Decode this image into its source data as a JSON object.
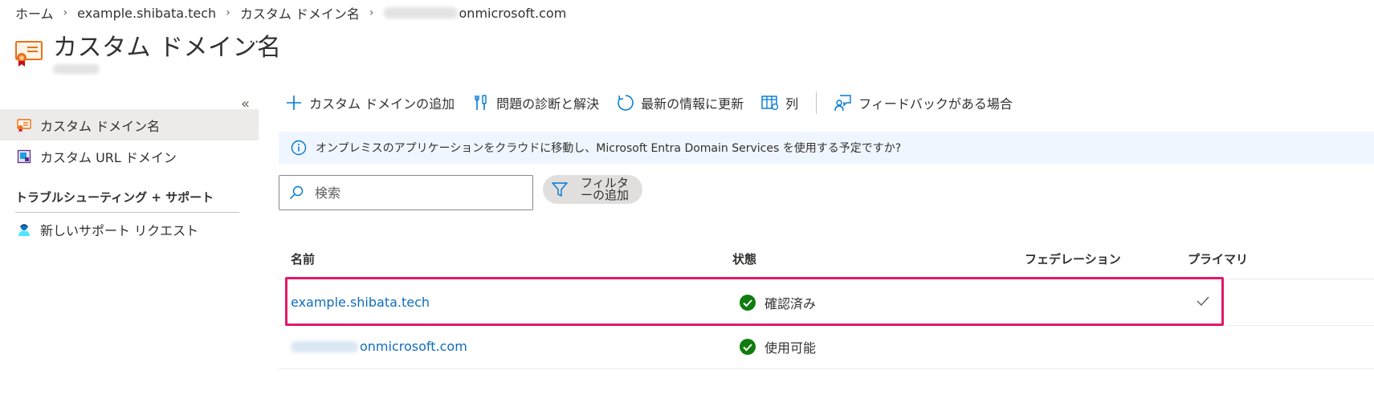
{
  "breadcrumb": {
    "home": "ホーム",
    "domain": "example.shibata.tech",
    "page": "カスタム ドメイン名",
    "tenant_suffix": "onmicrosoft.com"
  },
  "page": {
    "title": "カスタム ドメイン名",
    "more": "···",
    "collapse": "«"
  },
  "nav": {
    "items": [
      {
        "label": "カスタム ドメイン名",
        "icon": "certificate-icon",
        "active": true
      },
      {
        "label": "カスタム URL ドメイン",
        "icon": "url-domain-icon",
        "active": false
      }
    ],
    "section_title": "トラブルシューティング + サポート",
    "support_item": {
      "label": "新しいサポート リクエスト",
      "icon": "support-person-icon"
    }
  },
  "toolbar": {
    "add_domain": "カスタム ドメインの追加",
    "diagnose": "問題の診断と解決",
    "refresh": "最新の情報に更新",
    "columns": "列",
    "feedback": "フィードバックがある場合"
  },
  "info_banner": {
    "text": "オンプレミスのアプリケーションをクラウドに移動し、Microsoft Entra Domain Services を使用する予定ですか?"
  },
  "search": {
    "placeholder": "検索"
  },
  "filter": {
    "label_line1": "フィルタ",
    "label_line2": "ーの追加"
  },
  "table": {
    "headers": {
      "name": "名前",
      "status": "状態",
      "federation": "フェデレーション",
      "primary": "プライマリ"
    },
    "rows": [
      {
        "name": "example.shibata.tech",
        "status": "確認済み",
        "federation": "",
        "primary": true
      },
      {
        "name": "onmicrosoft.com",
        "status": "使用可能",
        "federation": "",
        "primary": false
      }
    ]
  },
  "colors": {
    "link": "#0f6cbd",
    "success": "#107c10",
    "highlight": "#e3186a",
    "info_bg": "#f0f6ff",
    "nav_active_bg": "#edebe9"
  }
}
